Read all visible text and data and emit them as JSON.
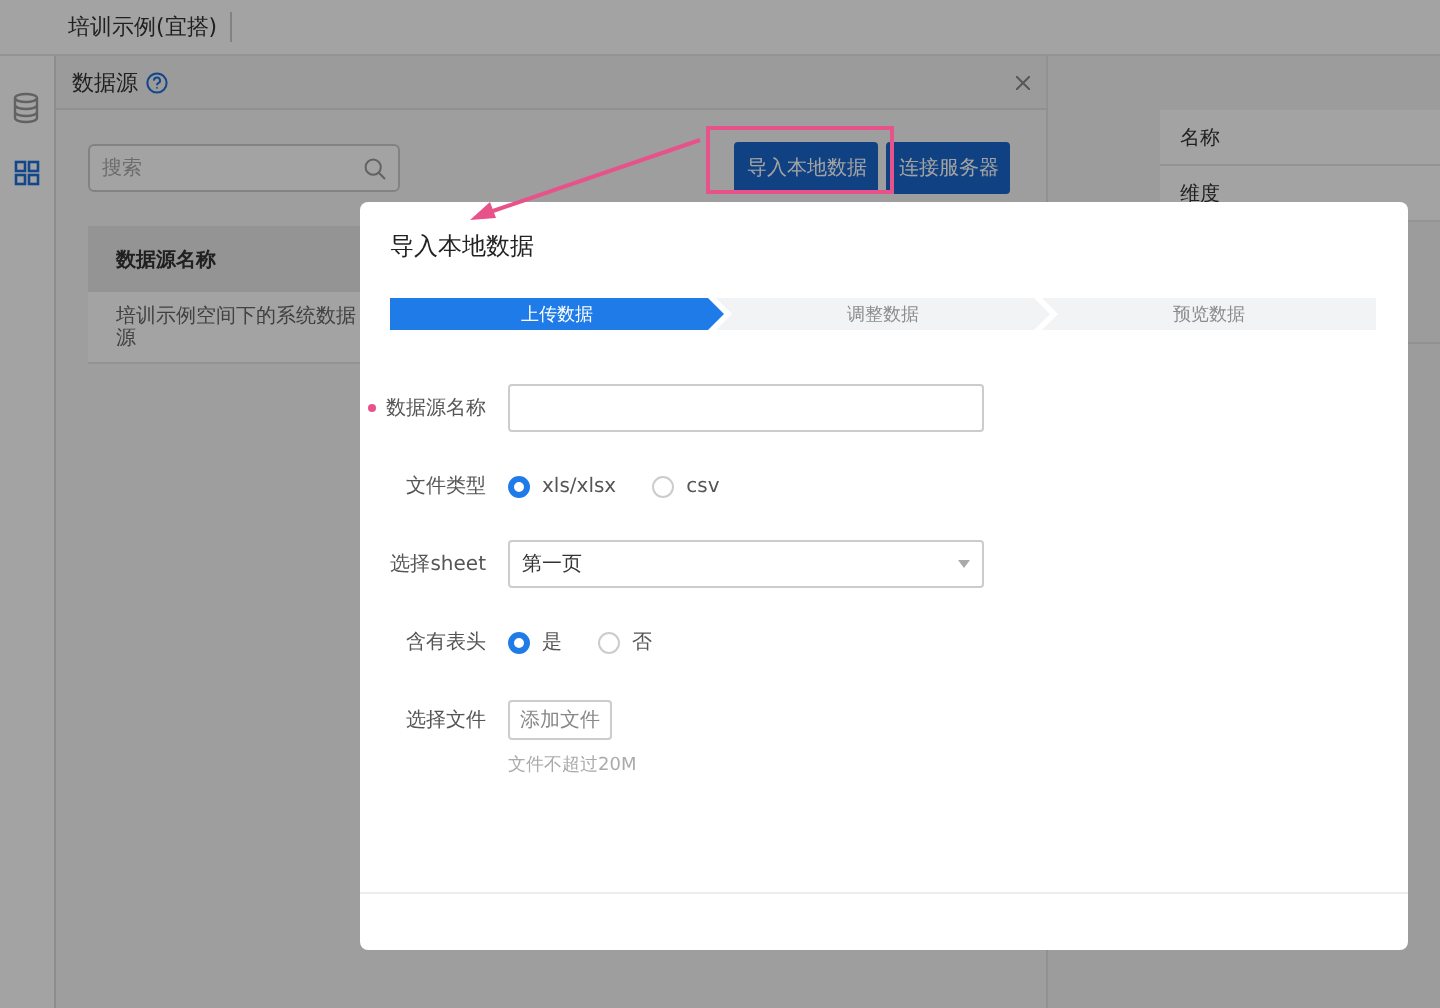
{
  "app_bar": {
    "title": "培训示例(宜搭)"
  },
  "side_rail": {
    "items": [
      {
        "kind": "database",
        "selected": false
      },
      {
        "kind": "grid",
        "selected": true
      }
    ]
  },
  "panel": {
    "title": "数据源",
    "search": {
      "placeholder": "搜索"
    },
    "buttons": [
      "导入本地数据",
      "连接服务器"
    ],
    "table": {
      "columns": [
        "数据源名称"
      ],
      "rows": [
        [
          "培训示例空间下的系统数据源"
        ]
      ]
    }
  },
  "side_panel": {
    "rows": [
      "名称",
      "维度"
    ]
  },
  "dialog": {
    "title": "导入本地数据",
    "steps": [
      {
        "label": "上传数据",
        "selected": true
      },
      {
        "label": "调整数据",
        "selected": false
      },
      {
        "label": "预览数据",
        "selected": false
      }
    ],
    "form": [
      {
        "kind": "text",
        "label": "数据源名称",
        "required": true
      },
      {
        "kind": "radio",
        "label": "文件类型",
        "required": false,
        "options": [
          {
            "label": "xls/xlsx",
            "selected": true
          },
          {
            "label": "csv",
            "selected": false
          }
        ]
      },
      {
        "kind": "select",
        "label": "选择sheet",
        "required": false,
        "value": "第一页"
      },
      {
        "kind": "radio",
        "label": "含有表头",
        "required": false,
        "options": [
          {
            "label": "是",
            "selected": true
          },
          {
            "label": "否",
            "selected": false
          }
        ]
      },
      {
        "kind": "upload",
        "label": "选择文件",
        "required": false,
        "button": "添加文件",
        "hint": "文件不超过20M"
      }
    ]
  }
}
